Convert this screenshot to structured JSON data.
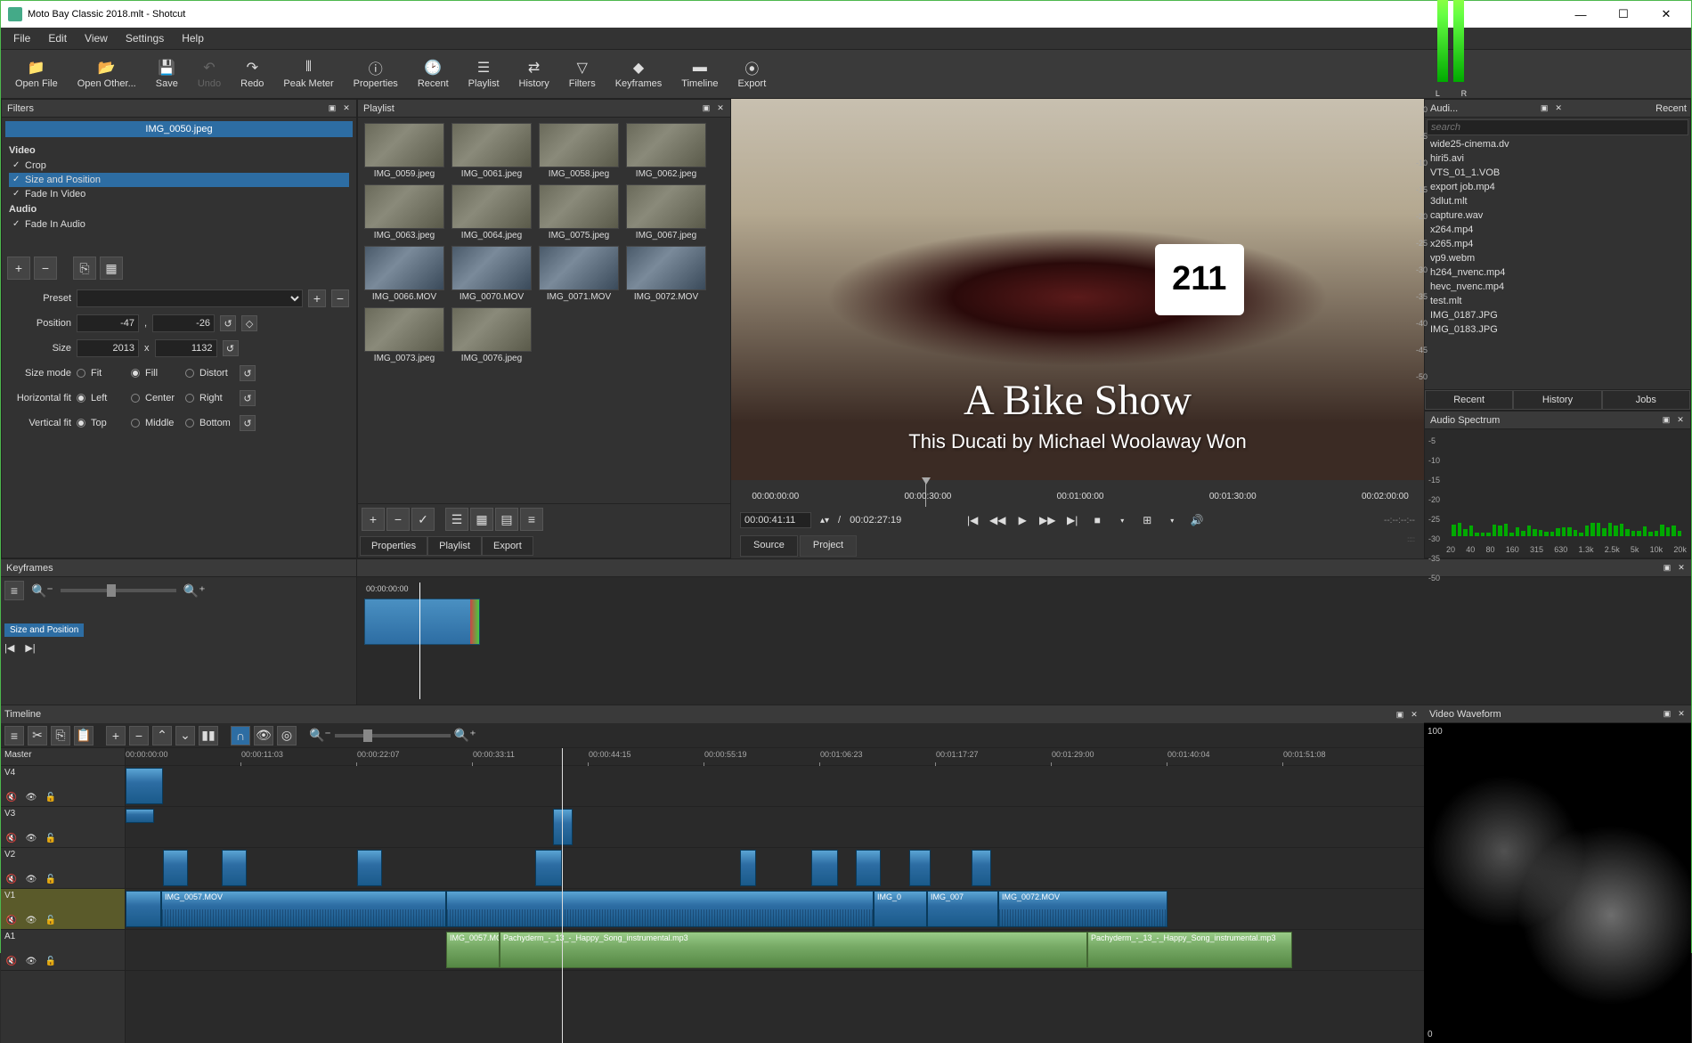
{
  "window": {
    "title": "Moto Bay Classic 2018.mlt - Shotcut"
  },
  "menu": [
    "File",
    "Edit",
    "View",
    "Settings",
    "Help"
  ],
  "toolbar": [
    {
      "icon": "folder",
      "label": "Open File"
    },
    {
      "icon": "folder-dot",
      "label": "Open Other..."
    },
    {
      "icon": "save",
      "label": "Save"
    },
    {
      "icon": "undo",
      "label": "Undo",
      "disabled": true
    },
    {
      "icon": "redo",
      "label": "Redo"
    },
    {
      "icon": "peak",
      "label": "Peak Meter"
    },
    {
      "icon": "prop",
      "label": "Properties"
    },
    {
      "icon": "recent",
      "label": "Recent"
    },
    {
      "icon": "playlist",
      "label": "Playlist"
    },
    {
      "icon": "history",
      "label": "History"
    },
    {
      "icon": "filters",
      "label": "Filters"
    },
    {
      "icon": "keyframes",
      "label": "Keyframes"
    },
    {
      "icon": "timeline",
      "label": "Timeline"
    },
    {
      "icon": "export",
      "label": "Export"
    }
  ],
  "filters": {
    "title": "Filters",
    "current": "IMG_0050.jpeg",
    "video_cat": "Video",
    "video_items": [
      "Crop",
      "Size and Position",
      "Fade In Video"
    ],
    "audio_cat": "Audio",
    "audio_items": [
      "Fade In Audio"
    ],
    "preset_label": "Preset",
    "position_label": "Position",
    "position_x": "-47",
    "position_y": "-26",
    "size_label": "Size",
    "size_w": "2013",
    "size_x": "x",
    "size_h": "1132",
    "sizemode_label": "Size mode",
    "sizemode": {
      "fit": "Fit",
      "fill": "Fill",
      "distort": "Distort"
    },
    "hfit_label": "Horizontal fit",
    "hfit": {
      "left": "Left",
      "center": "Center",
      "right": "Right"
    },
    "vfit_label": "Vertical fit",
    "vfit": {
      "top": "Top",
      "middle": "Middle",
      "bottom": "Bottom"
    }
  },
  "playlist": {
    "title": "Playlist",
    "items": [
      "IMG_0059.jpeg",
      "IMG_0061.jpeg",
      "IMG_0058.jpeg",
      "IMG_0062.jpeg",
      "IMG_0063.jpeg",
      "IMG_0064.jpeg",
      "IMG_0075.jpeg",
      "IMG_0067.jpeg",
      "IMG_0066.MOV",
      "IMG_0070.MOV",
      "IMG_0071.MOV",
      "IMG_0072.MOV",
      "IMG_0073.jpeg",
      "IMG_0076.jpeg"
    ],
    "tabs": [
      "Properties",
      "Playlist",
      "Export"
    ]
  },
  "preview": {
    "title_text": "A Bike Show",
    "subtitle_text": "This Ducati by Michael Woolaway Won",
    "number": "211",
    "ticks": [
      "00:00:00:00",
      "00:00:30:00",
      "00:01:00:00",
      "00:01:30:00",
      "00:02:00:00"
    ],
    "tc_current": "00:00:41:11",
    "tc_total": "00:02:27:19",
    "tabs": {
      "source": "Source",
      "project": "Project"
    }
  },
  "recent": {
    "title": "Recent",
    "search_ph": "search",
    "items": [
      "wide25-cinema.dv",
      "hiri5.avi",
      "VTS_01_1.VOB",
      "export job.mp4",
      "3dlut.mlt",
      "capture.wav",
      "x264.mp4",
      "x265.mp4",
      "vp9.webm",
      "h264_nvenc.mp4",
      "hevc_nvenc.mp4",
      "test.mlt",
      "IMG_0187.JPG",
      "IMG_0183.JPG"
    ],
    "tabs": [
      "Recent",
      "History",
      "Jobs"
    ]
  },
  "audio_meter": {
    "title": "Audi...",
    "scale": [
      "0",
      "-5",
      "-10",
      "-15",
      "-20",
      "-25",
      "-30",
      "-35",
      "-40",
      "-45",
      "-50"
    ],
    "L": "L",
    "R": "R"
  },
  "spectrum": {
    "title": "Audio Spectrum",
    "scale": [
      "-5",
      "-10",
      "-15",
      "-20",
      "-25",
      "-30",
      "-35",
      "-50"
    ],
    "freq": [
      "20",
      "40",
      "80",
      "160",
      "315",
      "630",
      "1.3k",
      "2.5k",
      "5k",
      "10k",
      "20k"
    ]
  },
  "keyframes": {
    "title": "Keyframes",
    "sp_label": "Size and Position",
    "tc": "00:00:00:00"
  },
  "timeline": {
    "title": "Timeline",
    "master": "Master",
    "tracks": [
      "V4",
      "V3",
      "V2",
      "V1",
      "A1"
    ],
    "ruler": [
      "00:00:00:00",
      "00:00:11:03",
      "00:00:22:07",
      "00:00:33:11",
      "00:00:44:15",
      "00:00:55:19",
      "00:01:06:23",
      "00:01:17:27",
      "00:01:29:00",
      "00:01:40:04",
      "00:01:51:08"
    ],
    "clip_labels": {
      "v1a": "IMG_0057.MOV",
      "v1b": "IMG_0",
      "v1c": "IMG_007",
      "v1d": "IMG_0072.MOV",
      "a1a": "IMG_0057.MO",
      "a1b": "Pachyderm_-_13_-_Happy_Song_instrumental.mp3",
      "a1c": "Pachyderm_-_13_-_Happy_Song_instrumental.mp3"
    }
  },
  "waveform": {
    "title": "Video Waveform",
    "top": "100",
    "bottom": "0"
  }
}
